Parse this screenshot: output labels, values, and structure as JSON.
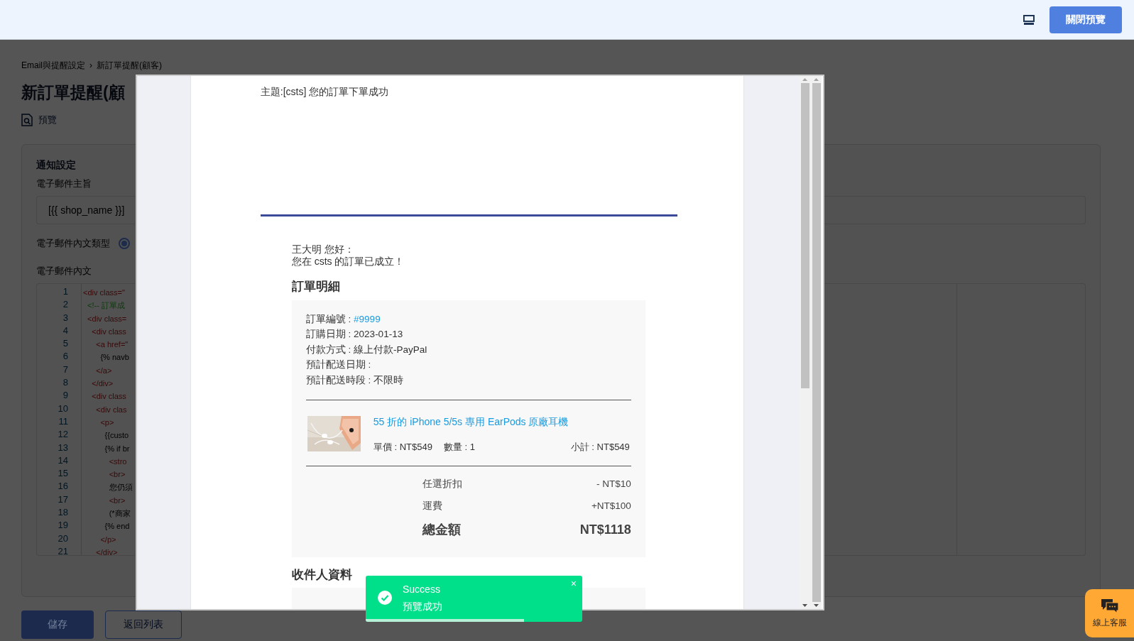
{
  "top_bar": {
    "close_preview_button": "關閉預覽"
  },
  "page": {
    "breadcrumb": [
      "Email與提醒設定",
      "新訂單提醒(顧客)"
    ],
    "breadcrumb_separator": "›",
    "title": "新訂單提醒(顧",
    "preview_link": "預覽",
    "section_title": "通知設定",
    "subject_label": "電子郵件主旨",
    "subject_value": "[{{ shop_name }}]",
    "body_type_label": "電子郵件內文類型",
    "body_type_radio": {
      "selected": true
    },
    "body_label": "電子郵件內文",
    "code_lines": [
      {
        "number": "1",
        "text": "<div class=\"",
        "kind": "tag"
      },
      {
        "number": "2",
        "text": "  <!-- 訂單成",
        "kind": "comment"
      },
      {
        "number": "3",
        "text": "  <div class=",
        "kind": "tag"
      },
      {
        "number": "4",
        "text": "    <div class",
        "kind": "tag"
      },
      {
        "number": "5",
        "text": "      <a href=\"",
        "kind": "tag"
      },
      {
        "number": "6",
        "text": "        {% navb",
        "kind": "template"
      },
      {
        "number": "7",
        "text": "      </a>",
        "kind": "tag"
      },
      {
        "number": "8",
        "text": "    </div>",
        "kind": "tag"
      },
      {
        "number": "9",
        "text": "    <div class",
        "kind": "tag"
      },
      {
        "number": "10",
        "text": "      <div clas",
        "kind": "tag"
      },
      {
        "number": "11",
        "text": "        <p>",
        "kind": "tag"
      },
      {
        "number": "12",
        "text": "          {{custo",
        "kind": "template"
      },
      {
        "number": "13",
        "text": "          {% if br",
        "kind": "template"
      },
      {
        "number": "14",
        "text": "            <stro",
        "kind": "tag"
      },
      {
        "number": "15",
        "text": "            <br>",
        "kind": "tag"
      },
      {
        "number": "16",
        "text": "            您仍須",
        "kind": "text"
      },
      {
        "number": "17",
        "text": "            <br>",
        "kind": "tag"
      },
      {
        "number": "18",
        "text": "            (*商家",
        "kind": "text"
      },
      {
        "number": "19",
        "text": "          {% end",
        "kind": "template"
      },
      {
        "number": "20",
        "text": "        </p>",
        "kind": "tag"
      },
      {
        "number": "21",
        "text": "      </div>",
        "kind": "tag"
      }
    ],
    "buttons": [
      {
        "label": "儲存",
        "kind": "primary"
      },
      {
        "label": "返回列表",
        "kind": "outline"
      }
    ]
  },
  "preview": {
    "subject": "主題:[csts] 您的訂單下單成功",
    "greeting": [
      "王大明 您好：",
      "您在 csts 的訂單已成立！"
    ],
    "order_heading": "訂單明細",
    "order_info": [
      {
        "label": "訂單編號 : ",
        "value": "#9999",
        "kind": "link"
      },
      {
        "label": "訂購日期 : ",
        "value": "2023-01-13",
        "kind": "plain"
      },
      {
        "label": "付款方式 : ",
        "value": "線上付款-PayPal",
        "kind": "plain"
      },
      {
        "label": "預計配送日期 :",
        "kind": "plain"
      },
      {
        "label": "預計配送時段 : ",
        "value": "不限時",
        "kind": "plain"
      }
    ],
    "item": {
      "name": "55 折的 iPhone 5/5s 專用 EarPods 原廠耳機",
      "unit_price": "單價 : NT$549",
      "quantity": "數量 : 1",
      "subtotal": "小計 : NT$549"
    },
    "summary": [
      {
        "label": "任選折扣",
        "value": "- NT$10",
        "kind": "normal"
      },
      {
        "label": "運費",
        "value": "+NT$100",
        "kind": "normal"
      },
      {
        "label": "總金額",
        "value": "NT$1118",
        "kind": "total"
      }
    ],
    "recipient_heading": "收件人資料"
  },
  "toast": {
    "title": "Success",
    "message": "預覽成功",
    "close": "×",
    "level": 0.73
  },
  "chat_button": {
    "label": "線上客服"
  }
}
